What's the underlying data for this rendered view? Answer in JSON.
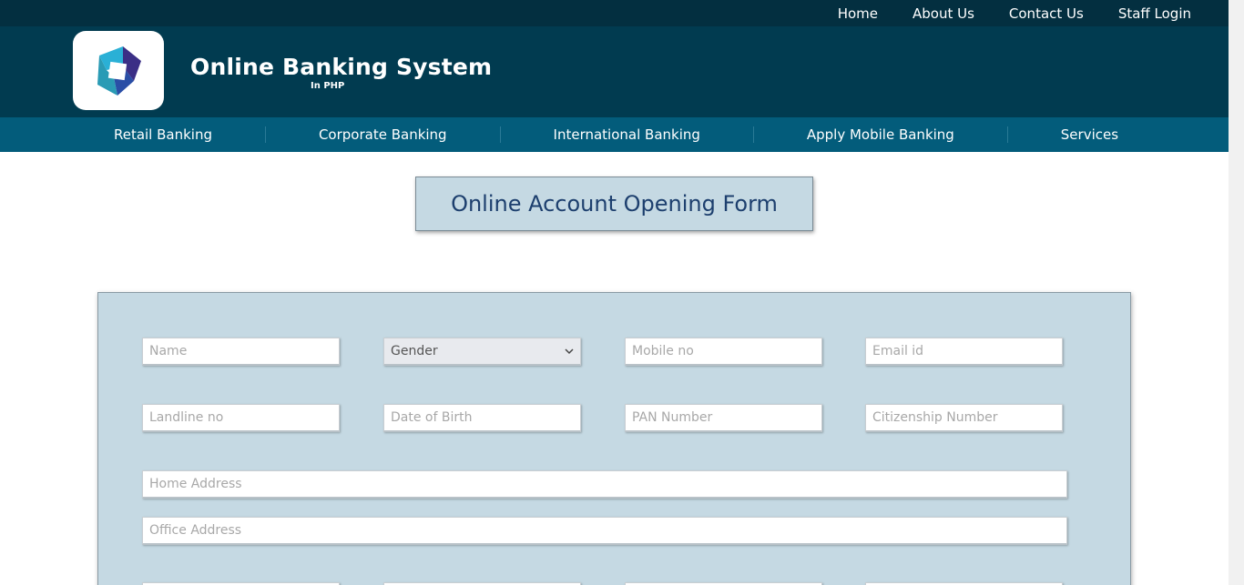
{
  "topbar": {
    "links": [
      "Home",
      "About Us",
      "Contact Us",
      "Staff Login"
    ]
  },
  "header": {
    "title": "Online Banking System",
    "subtitle": "In PHP",
    "logo_icon": "bank-logo-icon"
  },
  "nav": {
    "items": [
      "Retail Banking",
      "Corporate Banking",
      "International Banking",
      "Apply Mobile Banking",
      "Services"
    ]
  },
  "form": {
    "title": "Online Account Opening Form",
    "name_placeholder": "Name",
    "gender_selected": "Gender",
    "mobile_placeholder": "Mobile no",
    "email_placeholder": "Email id",
    "landline_placeholder": "Landline no",
    "dob_placeholder": "Date of Birth",
    "pan_placeholder": "PAN Number",
    "citizenship_placeholder": "Citizenship Number",
    "home_address_placeholder": "Home Address",
    "office_address_placeholder": "Office Address"
  },
  "colors": {
    "topbar": "#032f40",
    "header": "#013b50",
    "navbar": "#035c7b",
    "panel": "#c5d9e3",
    "title_text": "#1d3f6e"
  }
}
